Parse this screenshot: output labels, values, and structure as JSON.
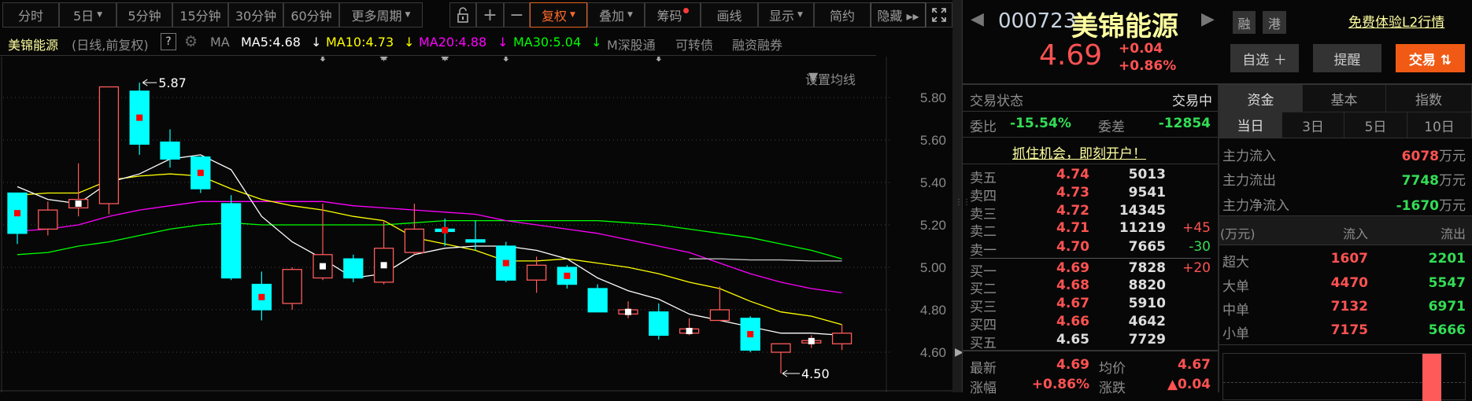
{
  "toolbar": {
    "periods": [
      {
        "label": "分时"
      },
      {
        "label": "5日",
        "dropdown": true
      },
      {
        "label": "5分钟"
      },
      {
        "label": "15分钟"
      },
      {
        "label": "30分钟"
      },
      {
        "label": "60分钟"
      },
      {
        "label": "更多周期",
        "dropdown": true
      }
    ],
    "tools": [
      {
        "label": "复权",
        "dropdown": true,
        "active": true
      },
      {
        "label": "叠加",
        "dropdown": true
      },
      {
        "label": "筹码",
        "badge": true
      },
      {
        "label": "画线"
      },
      {
        "label": "显示",
        "dropdown": true
      },
      {
        "label": "简约"
      },
      {
        "label": "隐藏 ▸▸"
      }
    ],
    "lock_icon": "unlock-icon",
    "plus": "+",
    "minus": "−",
    "fullscreen_icon": "fullscreen-icon"
  },
  "ma_bar": {
    "stock_name": "美锦能源",
    "mode": "(日线,前复权)",
    "help": "?",
    "ma_label": "MA",
    "ma5": "MA5:4.68",
    "ma10": "MA10:4.73",
    "ma20": "MA20:4.88",
    "ma30": "MA30:5.04",
    "arrow": "↓",
    "links": [
      "M深股通",
      "可转债",
      "融资融券"
    ],
    "settings": "设置均线"
  },
  "chart_data": {
    "type": "candlestick",
    "ylim": [
      4.5,
      5.9
    ],
    "yticks": [
      "5.80",
      "5.60",
      "5.40",
      "5.20",
      "5.00",
      "4.80",
      "4.60"
    ],
    "high_label": "5.87",
    "high_index": 4,
    "low_label": "4.50",
    "low_index": 25,
    "colors": {
      "up": "#ff5a5a",
      "down": "#00ffff",
      "ma5": "#ffffff",
      "ma10": "#ffff00",
      "ma20": "#ff00ff",
      "ma30": "#00ff00",
      "extra": "#bbbbbb"
    },
    "candles": [
      {
        "o": 5.35,
        "h": 5.35,
        "l": 5.11,
        "c": 5.16,
        "dot": "red"
      },
      {
        "o": 5.18,
        "h": 5.31,
        "l": 5.15,
        "c": 5.27
      },
      {
        "o": 5.28,
        "h": 5.49,
        "l": 5.24,
        "c": 5.32,
        "dot": "white"
      },
      {
        "o": 5.3,
        "h": 5.85,
        "l": 5.25,
        "c": 5.85
      },
      {
        "o": 5.83,
        "h": 5.87,
        "l": 5.53,
        "c": 5.58,
        "dot": "red"
      },
      {
        "o": 5.59,
        "h": 5.65,
        "l": 5.47,
        "c": 5.51
      },
      {
        "o": 5.52,
        "h": 5.52,
        "l": 5.35,
        "c": 5.37,
        "dot": "red"
      },
      {
        "o": 5.3,
        "h": 5.34,
        "l": 4.94,
        "c": 4.95
      },
      {
        "o": 4.92,
        "h": 4.98,
        "l": 4.75,
        "c": 4.8,
        "dot": "red"
      },
      {
        "o": 4.83,
        "h": 5.0,
        "l": 4.8,
        "c": 4.99
      },
      {
        "o": 4.95,
        "h": 5.3,
        "l": 4.94,
        "c": 5.06,
        "dot": "white"
      },
      {
        "o": 5.04,
        "h": 5.06,
        "l": 4.93,
        "c": 4.95
      },
      {
        "o": 4.93,
        "h": 5.22,
        "l": 4.92,
        "c": 5.09,
        "dot": "white"
      },
      {
        "o": 5.07,
        "h": 5.3,
        "l": 5.06,
        "c": 5.18
      },
      {
        "o": 5.18,
        "h": 5.23,
        "l": 5.1,
        "c": 5.17,
        "dot": "red"
      },
      {
        "o": 5.13,
        "h": 5.22,
        "l": 5.08,
        "c": 5.12
      },
      {
        "o": 5.1,
        "h": 5.12,
        "l": 4.93,
        "c": 4.94,
        "dot": "red"
      },
      {
        "o": 4.94,
        "h": 5.05,
        "l": 4.88,
        "c": 5.01
      },
      {
        "o": 5.0,
        "h": 5.01,
        "l": 4.9,
        "c": 4.92,
        "dot": "red"
      },
      {
        "o": 4.9,
        "h": 4.92,
        "l": 4.79,
        "c": 4.79
      },
      {
        "o": 4.78,
        "h": 4.84,
        "l": 4.76,
        "c": 4.8,
        "dot": "white"
      },
      {
        "o": 4.79,
        "h": 4.83,
        "l": 4.66,
        "c": 4.68
      },
      {
        "o": 4.69,
        "h": 4.76,
        "l": 4.68,
        "c": 4.71,
        "dot": "white"
      },
      {
        "o": 4.75,
        "h": 4.91,
        "l": 4.75,
        "c": 4.8
      },
      {
        "o": 4.76,
        "h": 4.77,
        "l": 4.6,
        "c": 4.61,
        "dot": "red"
      },
      {
        "o": 4.6,
        "h": 4.64,
        "l": 4.5,
        "c": 4.64
      },
      {
        "o": 4.65,
        "h": 4.68,
        "l": 4.62,
        "c": 4.655,
        "dot": "white"
      },
      {
        "o": 4.64,
        "h": 4.73,
        "l": 4.61,
        "c": 4.69
      }
    ],
    "ma5": [
      5.38,
      5.32,
      5.3,
      5.4,
      5.44,
      5.51,
      5.53,
      5.46,
      5.24,
      5.12,
      5.04,
      4.95,
      4.97,
      5.06,
      5.09,
      5.1,
      5.1,
      5.08,
      5.04,
      4.95,
      4.89,
      4.85,
      4.78,
      4.75,
      4.72,
      4.69,
      4.69,
      4.68
    ],
    "ma10": [
      5.34,
      5.35,
      5.35,
      5.41,
      5.43,
      5.44,
      5.43,
      5.37,
      5.32,
      5.29,
      5.27,
      5.24,
      5.22,
      5.14,
      5.11,
      5.08,
      5.03,
      5.03,
      5.04,
      5.02,
      5.0,
      4.97,
      4.93,
      4.9,
      4.84,
      4.79,
      4.77,
      4.73
    ],
    "ma20": [
      5.17,
      5.18,
      5.2,
      5.24,
      5.27,
      5.29,
      5.31,
      5.31,
      5.31,
      5.31,
      5.31,
      5.29,
      5.28,
      5.27,
      5.26,
      5.25,
      5.22,
      5.2,
      5.18,
      5.16,
      5.13,
      5.1,
      5.07,
      5.02,
      4.97,
      4.93,
      4.9,
      4.88
    ],
    "ma30": [
      5.06,
      5.07,
      5.1,
      5.12,
      5.15,
      5.18,
      5.2,
      5.21,
      5.2,
      5.2,
      5.2,
      5.2,
      5.2,
      5.21,
      5.22,
      5.22,
      5.22,
      5.22,
      5.22,
      5.22,
      5.21,
      5.2,
      5.18,
      5.16,
      5.14,
      5.11,
      5.08,
      5.04
    ],
    "extra": [
      null,
      null,
      null,
      null,
      null,
      null,
      null,
      null,
      null,
      null,
      null,
      null,
      null,
      null,
      null,
      null,
      null,
      null,
      null,
      null,
      null,
      null,
      5.04,
      5.04,
      5.035,
      5.035,
      5.03,
      5.03
    ],
    "events": [
      {
        "index": 10,
        "glyph": "⬍"
      },
      {
        "index": 12,
        "glyph": "✸"
      },
      {
        "index": 14,
        "glyph": "✸"
      },
      {
        "index": 16,
        "glyph": "⬍"
      },
      {
        "index": 21,
        "glyph": "⬍"
      }
    ]
  },
  "quote": {
    "code": "000723",
    "name": "美锦能源",
    "tags": [
      "融",
      "港"
    ],
    "l2_link": "免费体验L2行情",
    "price": "4.69",
    "change": "+0.04",
    "change_pct": "+0.86%",
    "watch_btn": "自选 ＋",
    "alert_btn": "提醒",
    "trade_btn": "交易 ⇅",
    "status_label": "交易状态",
    "status_value": "交易中",
    "wb_label": "委比",
    "wb_value": "-15.54%",
    "wc_label": "委差",
    "wc_value": "-12854",
    "promo": "抓住机会，即刻开户！",
    "asks": [
      {
        "label": "卖五",
        "price": "4.74",
        "vol": "5013",
        "delta": ""
      },
      {
        "label": "卖四",
        "price": "4.73",
        "vol": "9541",
        "delta": ""
      },
      {
        "label": "卖三",
        "price": "4.72",
        "vol": "14345",
        "delta": ""
      },
      {
        "label": "卖二",
        "price": "4.71",
        "vol": "11219",
        "delta": "+45"
      },
      {
        "label": "卖一",
        "price": "4.70",
        "vol": "7665",
        "delta": "-30"
      }
    ],
    "bids": [
      {
        "label": "买一",
        "price": "4.69",
        "vol": "7828",
        "delta": "+20"
      },
      {
        "label": "买二",
        "price": "4.68",
        "vol": "8820",
        "delta": ""
      },
      {
        "label": "买三",
        "price": "4.67",
        "vol": "5910",
        "delta": ""
      },
      {
        "label": "买四",
        "price": "4.66",
        "vol": "4642",
        "delta": ""
      },
      {
        "label": "买五",
        "price": "4.65",
        "vol": "7729",
        "delta": ""
      }
    ],
    "last_label": "最新",
    "last": "4.69",
    "avg_label": "均价",
    "avg": "4.67",
    "pct_label": "涨幅",
    "pct": "+0.86%",
    "chg_label": "涨跌",
    "chg": "▲0.04"
  },
  "funds": {
    "tabs": [
      "资金",
      "基本",
      "指数"
    ],
    "periods": [
      "当日",
      "3日",
      "5日",
      "10日"
    ],
    "main_in_label": "主力流入",
    "main_in": "6078",
    "main_out_label": "主力流出",
    "main_out": "7748",
    "net_label": "主力净流入",
    "net": "-1670",
    "unit": "万元",
    "table_unit": "(万元)",
    "col_in": "流入",
    "col_out": "流出",
    "rows": [
      {
        "label": "超大",
        "in": "1607",
        "out": "2201"
      },
      {
        "label": "大单",
        "in": "4470",
        "out": "5547"
      },
      {
        "label": "中单",
        "in": "7132",
        "out": "6971"
      },
      {
        "label": "小单",
        "in": "7175",
        "out": "5666"
      }
    ]
  }
}
